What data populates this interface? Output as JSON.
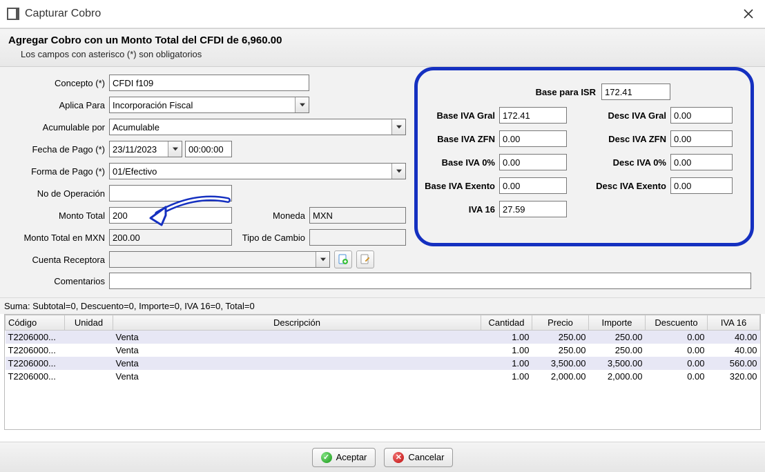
{
  "window": {
    "title": "Capturar Cobro"
  },
  "header": {
    "main": "Agregar Cobro con un Monto Total del CFDI de 6,960.00",
    "sub": "Los campos con asterisco (*) son obligatorios"
  },
  "labels": {
    "concepto": "Concepto (*)",
    "aplica": "Aplica Para",
    "acumulable": "Acumulable por",
    "fecha": "Fecha de Pago (*)",
    "forma": "Forma de Pago (*)",
    "noop": "No de Operación",
    "monto": "Monto Total",
    "moneda": "Moneda",
    "montomxn": "Monto Total en MXN",
    "tipocambio": "Tipo de Cambio",
    "cuenta": "Cuenta Receptora",
    "coment": "Comentarios"
  },
  "values": {
    "concepto": "CFDI f109",
    "aplica": "Incorporación Fiscal",
    "acumulable": "Acumulable",
    "fecha": "23/11/2023",
    "hora": "00:00:00",
    "forma": "01/Efectivo",
    "noop": "",
    "monto": "200",
    "moneda": "MXN",
    "montomxn": "200.00",
    "tipocambio": "",
    "cuenta": "",
    "coment": ""
  },
  "tax": {
    "lbl_isr": "Base para ISR",
    "isr": "172.41",
    "lbl_ivagral": "Base IVA Gral",
    "ivagral": "172.41",
    "lbl_ivazfn": "Base IVA ZFN",
    "ivazfn": "0.00",
    "lbl_iva0": "Base IVA 0%",
    "iva0": "0.00",
    "lbl_ivaex": "Base IVA Exento",
    "ivaex": "0.00",
    "lbl_iva16": "IVA 16",
    "iva16": "27.59",
    "lbl_descgral": "Desc IVA Gral",
    "descgral": "0.00",
    "lbl_desczfn": "Desc IVA ZFN",
    "desczfn": "0.00",
    "lbl_desc0": "Desc IVA 0%",
    "desc0": "0.00",
    "lbl_descex": "Desc IVA Exento",
    "descex": "0.00"
  },
  "sumline": "Suma:  Subtotal=0, Descuento=0, Importe=0, IVA 16=0, Total=0",
  "grid": {
    "headers": {
      "codigo": "Código",
      "unidad": "Unidad",
      "desc": "Descripción",
      "cant": "Cantidad",
      "precio": "Precio",
      "importe": "Importe",
      "descuento": "Descuento",
      "iva": "IVA 16"
    },
    "rows": [
      {
        "codigo": "T2206000...",
        "unidad": "",
        "desc": "Venta",
        "cant": "1.00",
        "precio": "250.00",
        "importe": "250.00",
        "descuento": "0.00",
        "iva": "40.00"
      },
      {
        "codigo": "T2206000...",
        "unidad": "",
        "desc": "Venta",
        "cant": "1.00",
        "precio": "250.00",
        "importe": "250.00",
        "descuento": "0.00",
        "iva": "40.00"
      },
      {
        "codigo": "T2206000...",
        "unidad": "",
        "desc": "Venta",
        "cant": "1.00",
        "precio": "3,500.00",
        "importe": "3,500.00",
        "descuento": "0.00",
        "iva": "560.00"
      },
      {
        "codigo": "T2206000...",
        "unidad": "",
        "desc": "Venta",
        "cant": "1.00",
        "precio": "2,000.00",
        "importe": "2,000.00",
        "descuento": "0.00",
        "iva": "320.00"
      }
    ]
  },
  "buttons": {
    "accept": "Aceptar",
    "cancel": "Cancelar"
  }
}
